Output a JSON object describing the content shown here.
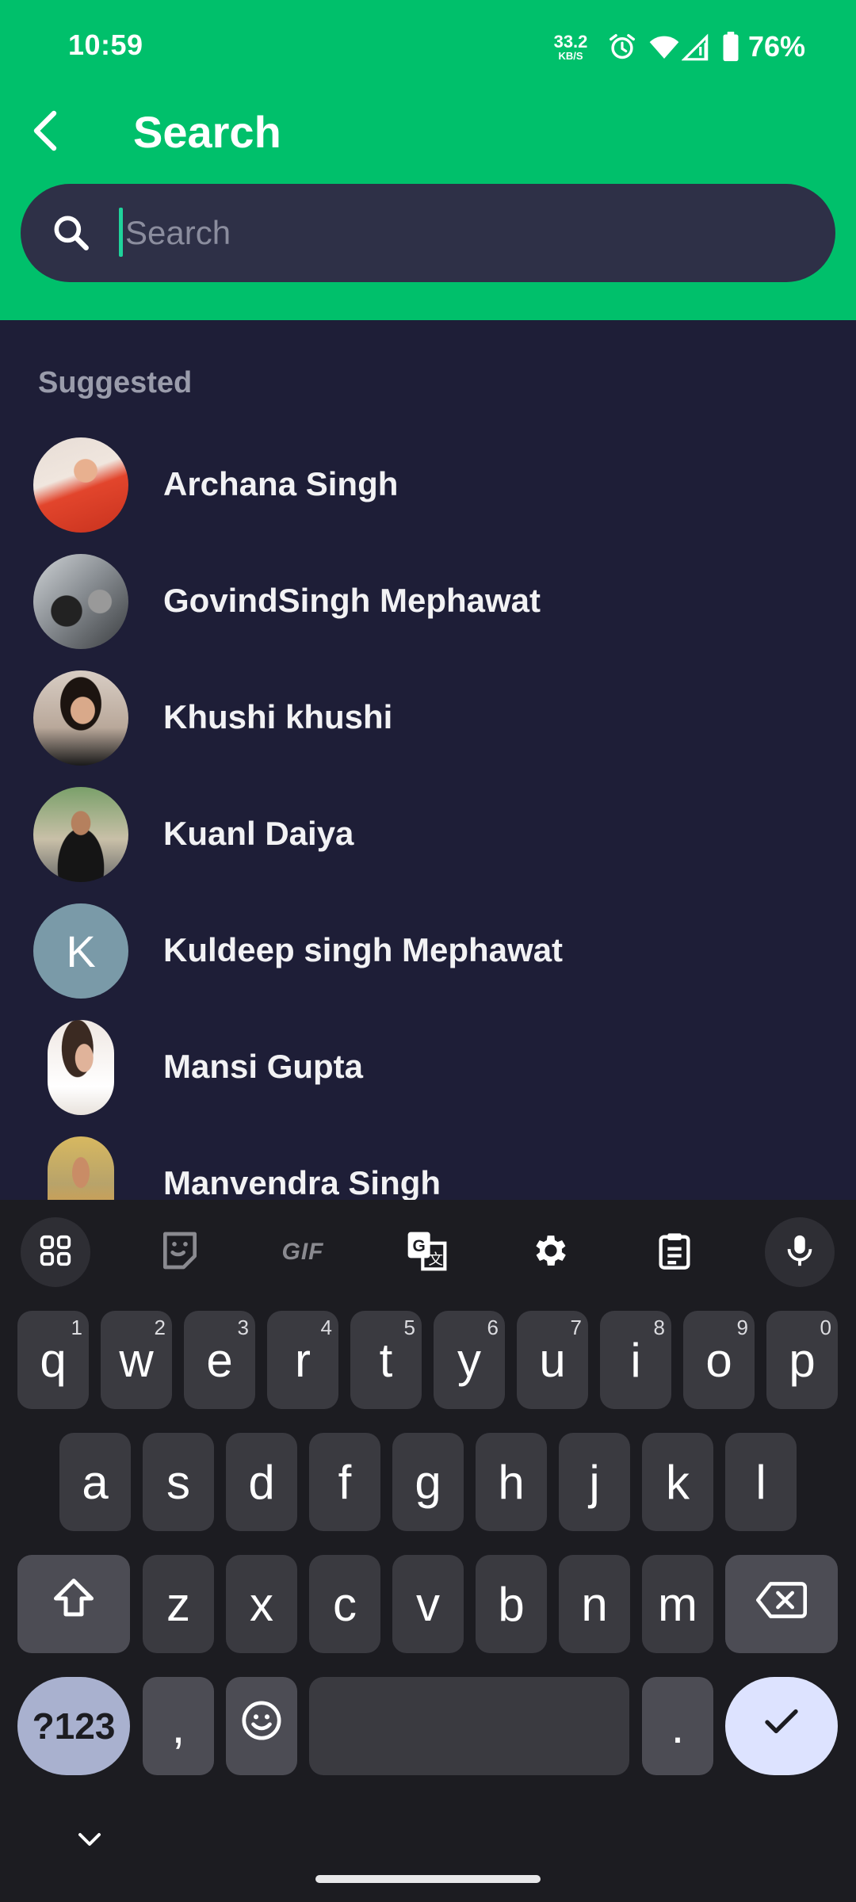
{
  "status_bar": {
    "time": "10:59",
    "net_speed_value": "33.2",
    "net_speed_unit": "KB/S",
    "battery_percent": "76%"
  },
  "header": {
    "title": "Search",
    "search_placeholder": "Search",
    "search_value": ""
  },
  "suggested": {
    "label": "Suggested",
    "contacts": [
      {
        "name": "Archana Singh",
        "avatar": "photo"
      },
      {
        "name": "GovindSingh Mephawat",
        "avatar": "photo"
      },
      {
        "name": "Khushi khushi",
        "avatar": "photo"
      },
      {
        "name": "Kuanl Daiya",
        "avatar": "photo"
      },
      {
        "name": "Kuldeep singh Mephawat",
        "avatar": "K"
      },
      {
        "name": "Mansi Gupta",
        "avatar": "photo"
      },
      {
        "name": "Manvendra Singh",
        "avatar": "photo"
      }
    ]
  },
  "keyboard": {
    "toolbar": {
      "gif_label": "GIF"
    },
    "row1": [
      {
        "key": "q",
        "hint": "1"
      },
      {
        "key": "w",
        "hint": "2"
      },
      {
        "key": "e",
        "hint": "3"
      },
      {
        "key": "r",
        "hint": "4"
      },
      {
        "key": "t",
        "hint": "5"
      },
      {
        "key": "y",
        "hint": "6"
      },
      {
        "key": "u",
        "hint": "7"
      },
      {
        "key": "i",
        "hint": "8"
      },
      {
        "key": "o",
        "hint": "9"
      },
      {
        "key": "p",
        "hint": "0"
      }
    ],
    "row2": [
      "a",
      "s",
      "d",
      "f",
      "g",
      "h",
      "j",
      "k",
      "l"
    ],
    "row3": [
      "z",
      "x",
      "c",
      "v",
      "b",
      "n",
      "m"
    ],
    "symbols_label": "?123",
    "comma_label": ",",
    "period_label": "."
  },
  "colors": {
    "accent": "#00c06b",
    "background": "#1e1e37",
    "search_field": "#2e3047",
    "caret": "#1fd39b",
    "keyboard": "#1c1c21"
  }
}
